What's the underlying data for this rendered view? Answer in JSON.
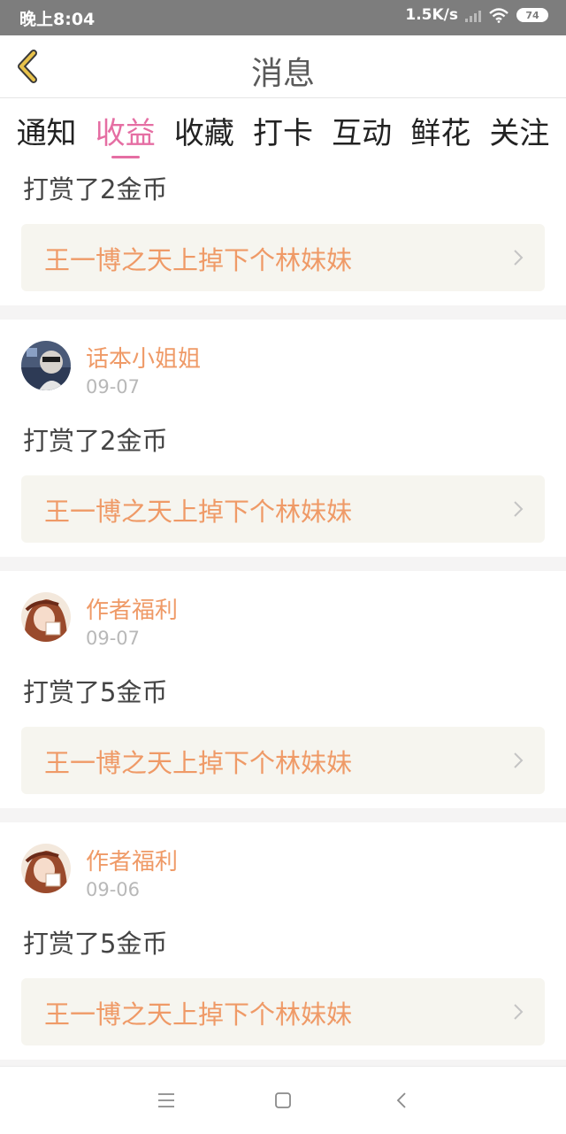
{
  "status_bar": {
    "time": "晚上8:04",
    "net_speed": "1.5K/s",
    "battery": "74"
  },
  "header": {
    "title": "消息",
    "back_icon": "chevron-left-icon",
    "accent_color": "#e8c24b"
  },
  "tabs": [
    {
      "label": "通知",
      "active": false
    },
    {
      "label": "收益",
      "active": true
    },
    {
      "label": "收藏",
      "active": false
    },
    {
      "label": "打卡",
      "active": false
    },
    {
      "label": "互动",
      "active": false
    },
    {
      "label": "鲜花",
      "active": false
    },
    {
      "label": "关注",
      "active": false
    }
  ],
  "active_tab_color": "#e56ea3",
  "items": [
    {
      "user": "",
      "date": "",
      "reward_text": "打赏了2金币",
      "book_title": "王一博之天上掉下个林妹妹"
    },
    {
      "user": "话本小姐姐",
      "date": "09-07",
      "reward_text": "打赏了2金币",
      "book_title": "王一博之天上掉下个林妹妹"
    },
    {
      "user": "作者福利",
      "date": "09-07",
      "reward_text": "打赏了5金币",
      "book_title": "王一博之天上掉下个林妹妹"
    },
    {
      "user": "作者福利",
      "date": "09-06",
      "reward_text": "打赏了5金币",
      "book_title": "王一博之天上掉下个林妹妹"
    }
  ],
  "nav_bar": {
    "icons": [
      "menu-icon",
      "home-square-icon",
      "back-chevron-icon"
    ]
  }
}
